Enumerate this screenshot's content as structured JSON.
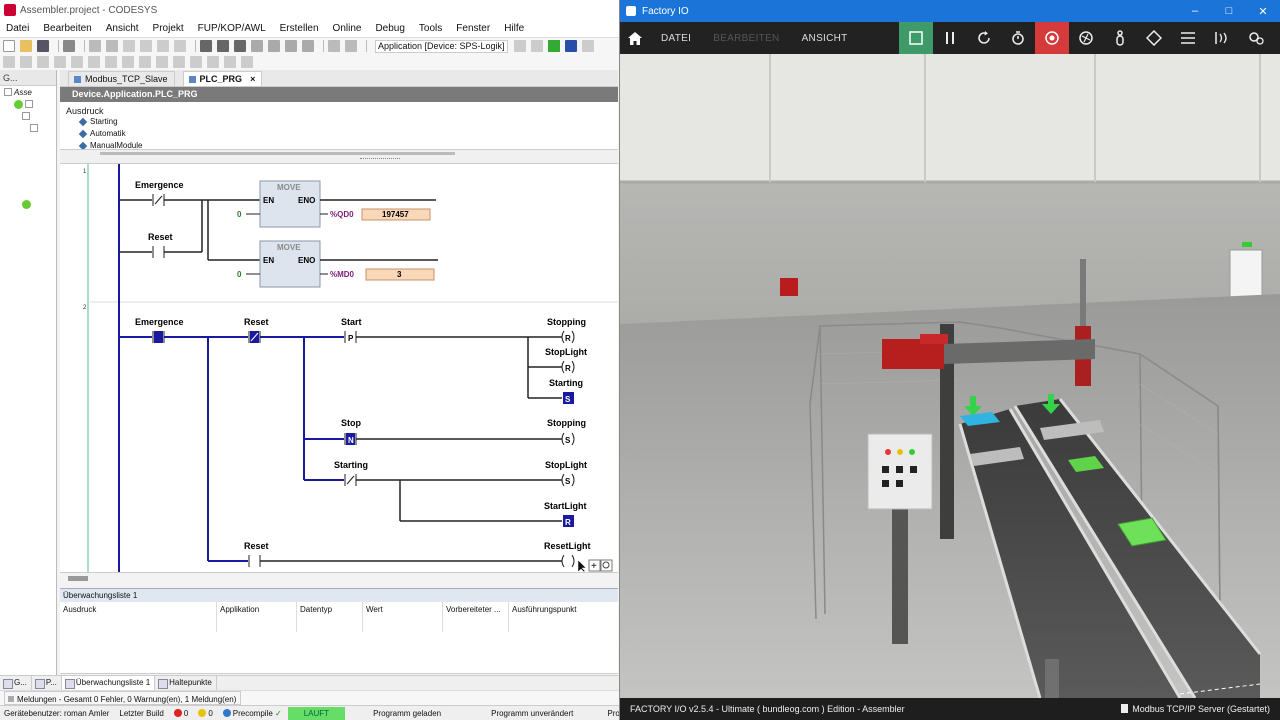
{
  "codesys": {
    "title": "Assembler.project - CODESYS",
    "menu": [
      "Datei",
      "Bearbeiten",
      "Ansicht",
      "Projekt",
      "FUP/KOP/AWL",
      "Erstellen",
      "Online",
      "Debug",
      "Tools",
      "Fenster",
      "Hilfe"
    ],
    "app_select": "Application [Device: SPS-Logik]",
    "left_panel_head": "G...",
    "tree_label": "Asse",
    "tabs": [
      {
        "label": "Modbus_TCP_Slave",
        "active": false
      },
      {
        "label": "PLC_PRG",
        "active": true
      }
    ],
    "tab_close": "×",
    "pou_path": "Device.Application.PLC_PRG",
    "declaration": {
      "header": "Ausdruck",
      "items": [
        "Starting",
        "Automatik",
        "ManualModule"
      ]
    },
    "ladder": {
      "net1_number": "1",
      "net2_number": "2",
      "net1": {
        "contact_emergence": "Emergence",
        "contact_reset": "Reset",
        "move1": {
          "title": "MOVE",
          "en": "EN",
          "eno": "ENO",
          "input": "0",
          "output_var": "%QD0",
          "output_value": "197457"
        },
        "move2": {
          "title": "MOVE",
          "en": "EN",
          "eno": "ENO",
          "input": "0",
          "output_var": "%MD0",
          "output_value": "3"
        }
      },
      "net2": {
        "contacts": {
          "emergence": "Emergence",
          "reset1": "Reset",
          "start": "Start",
          "stop": "Stop",
          "starting": "Starting",
          "reset2": "Reset"
        },
        "contact_marks": {
          "start": "P",
          "stop": "N"
        },
        "coils": [
          {
            "label": "Stopping",
            "mark": "R"
          },
          {
            "label": "StopLight",
            "mark": "R"
          },
          {
            "label": "Starting",
            "mark": "S"
          },
          {
            "label": "Stopping",
            "mark": "S"
          },
          {
            "label": "StopLight",
            "mark": "S"
          },
          {
            "label": "StartLight",
            "mark": "R"
          },
          {
            "label": "ResetLight",
            "mark": ""
          }
        ]
      }
    },
    "watch": {
      "title": "Überwachungsliste 1",
      "columns": [
        "Ausdruck",
        "Applikation",
        "Datentyp",
        "Wert",
        "Vorbereiteter ...",
        "Ausführungspunkt"
      ]
    },
    "bottom_tabs": [
      "G...",
      "P...",
      "Überwachungsliste 1",
      "Haltepunkte"
    ],
    "messages": "Meldungen - Gesamt 0 Fehler, 0 Warnung(en), 1 Meldung(en)",
    "status": {
      "user": "Gerätebenutzer: roman Amler",
      "last_build": "Letzter Build",
      "errors": "0",
      "warnings": "0",
      "precompile": "Precompile",
      "precompile_check": "✓",
      "run_state": "LAUFT",
      "program_loaded": "Programm geladen",
      "program_unchanged": "Programm unverändert",
      "project": "Proje"
    }
  },
  "factoryio": {
    "title": "Factory IO",
    "menu": {
      "datei": "DATEI",
      "bearbeiten": "BEARBEITEN",
      "ansicht": "ANSICHT"
    },
    "window_controls": {
      "minimize": "–",
      "maximize": "□",
      "close": "✕"
    },
    "status_left": "FACTORY I/O v2.5.4 - Ultimate ( bundleog.com ) Edition - Assembler",
    "status_right": "Modbus TCP/IP Server (Gestartet)"
  }
}
